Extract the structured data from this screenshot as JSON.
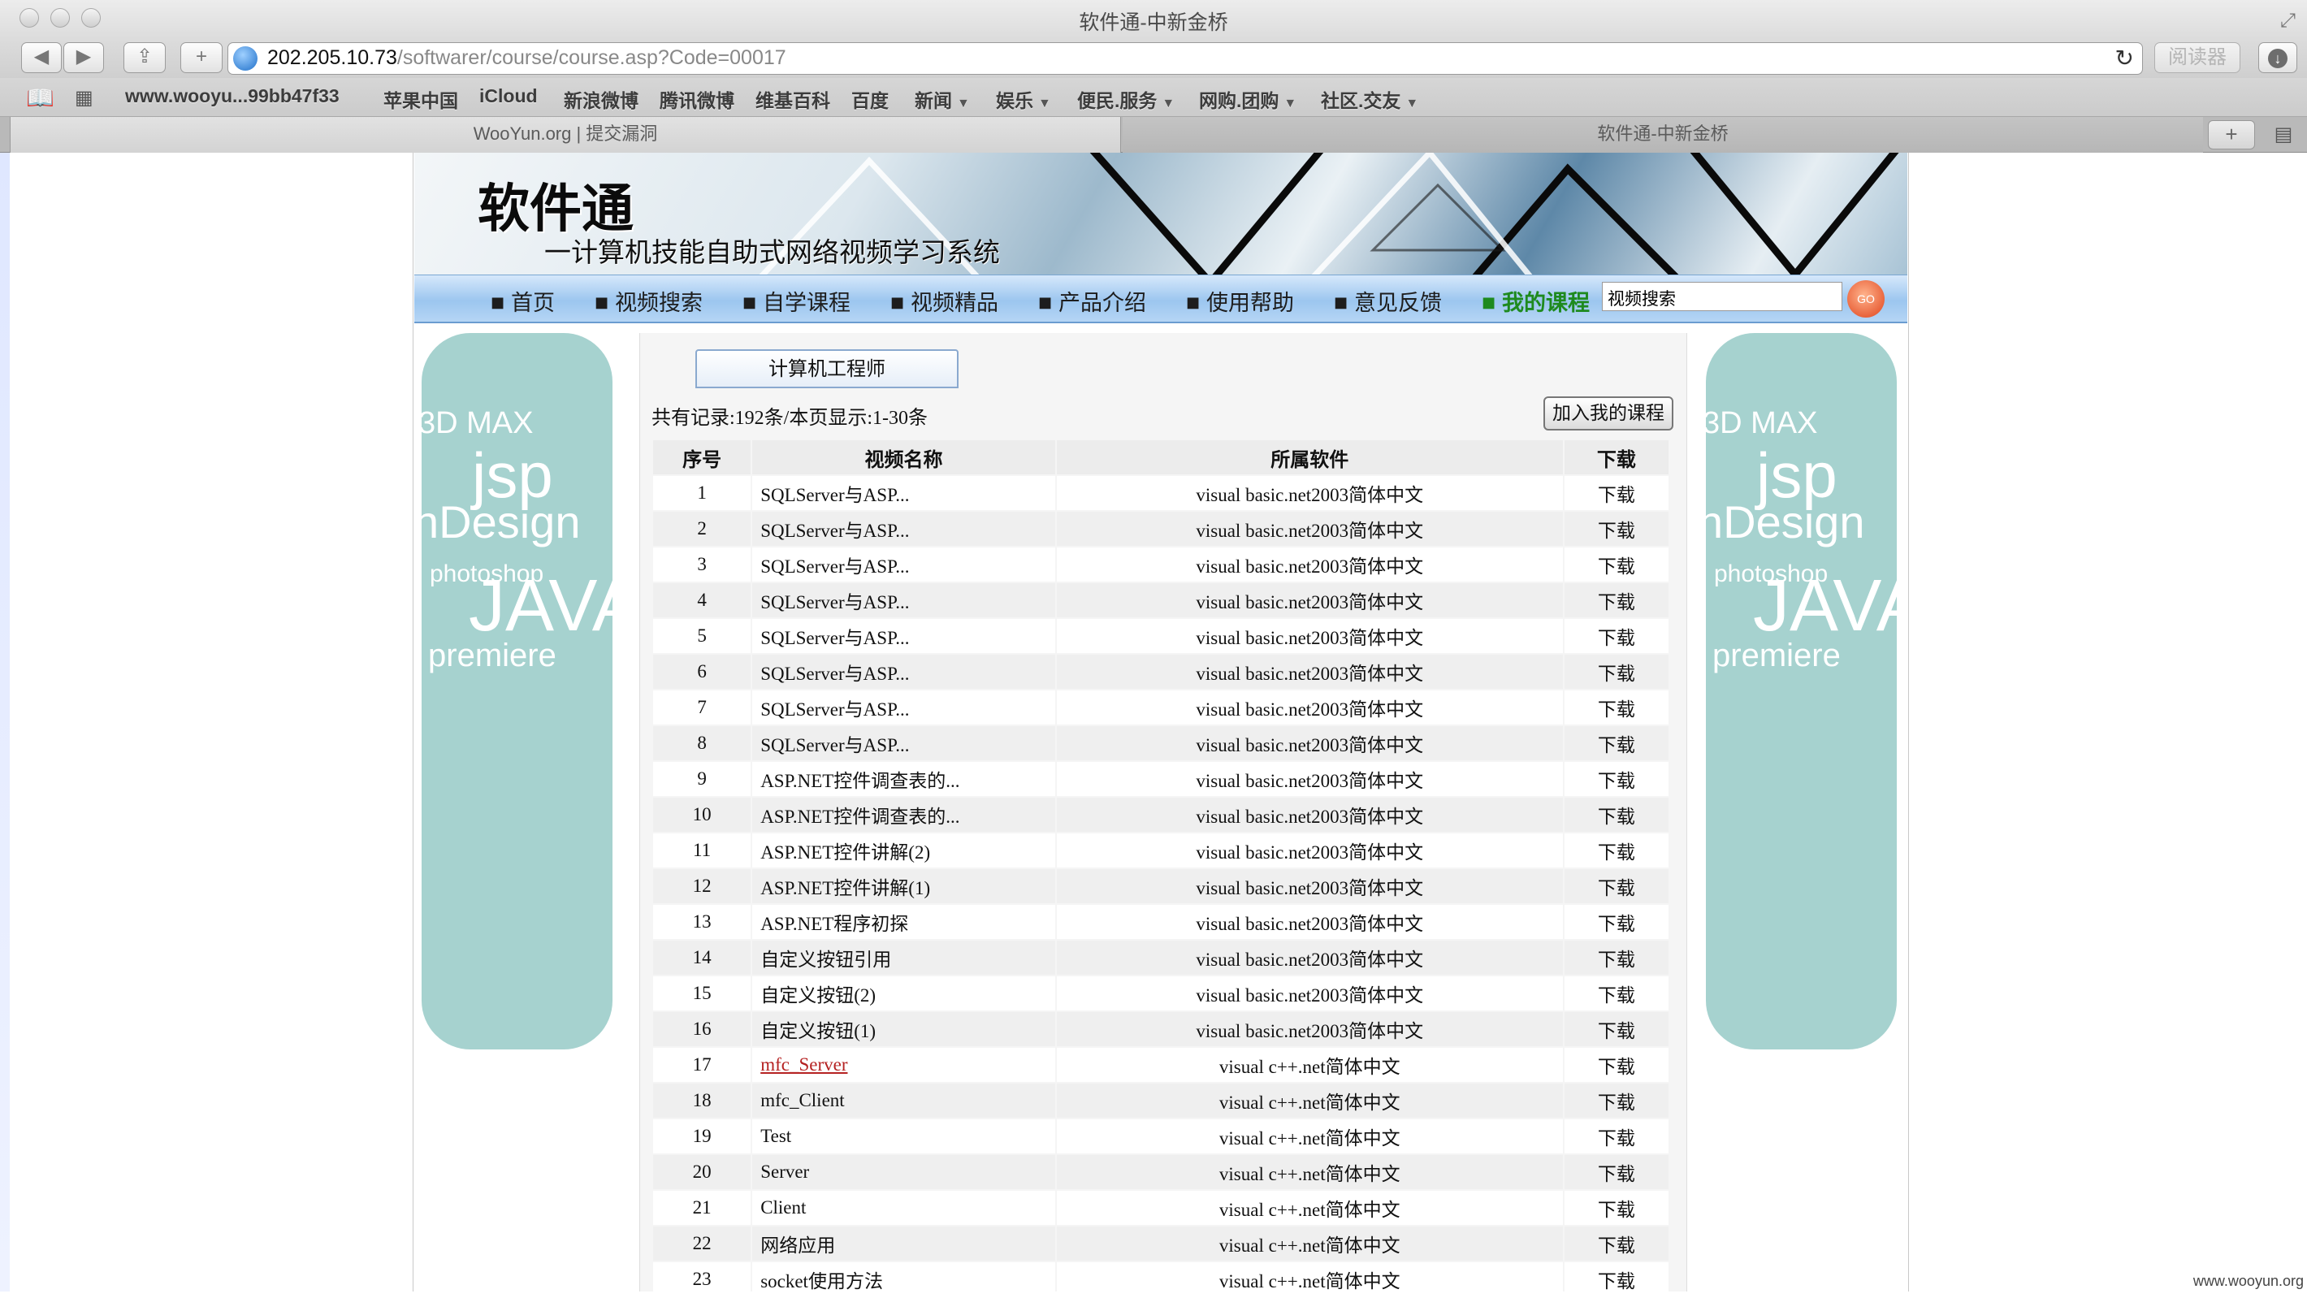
{
  "window": {
    "title": "软件通-中新金桥"
  },
  "toolbar": {
    "url_host": "202.205.10.73",
    "url_path": "/softwarer/course/course.asp?Code=00017",
    "reader_label": "阅读器"
  },
  "bookmarks": [
    {
      "label": "www.wooyu...99bb47f33"
    },
    {
      "label": "苹果中国"
    },
    {
      "label": "iCloud"
    },
    {
      "label": "新浪微博"
    },
    {
      "label": "腾讯微博"
    },
    {
      "label": "维基百科"
    },
    {
      "label": "百度"
    },
    {
      "label": "新闻"
    },
    {
      "label": "娱乐"
    },
    {
      "label": "便民.服务"
    },
    {
      "label": "网购.团购"
    },
    {
      "label": "社区.交友"
    }
  ],
  "tabs": [
    {
      "label": "WooYun.org | 提交漏洞"
    },
    {
      "label": "软件通-中新金桥"
    }
  ],
  "banner": {
    "title": "软件通",
    "subtitle": "一计算机技能自助式网络视频学习系统"
  },
  "nav": {
    "items": [
      "首页",
      "视频搜索",
      "自学课程",
      "视频精品",
      "产品介绍",
      "使用帮助",
      "意见反馈",
      "我的课程"
    ],
    "search_value": "视频搜索",
    "go_label": "GO"
  },
  "side_words": {
    "w1": "3D MAX",
    "w2": "jsp",
    "w3": "nDesign",
    "w4": "photoshop",
    "w5": "JAVA",
    "w6": "premiere"
  },
  "content": {
    "category_tab": "计算机工程师",
    "records_text": "共有记录:192条/本页显示:1-30条",
    "add_button": "加入我的课程",
    "columns": [
      "序号",
      "视频名称",
      "所属软件",
      "下载"
    ],
    "rows": [
      {
        "no": "1",
        "name": "SQLServer与ASP...",
        "software": "visual basic.net2003简体中文",
        "dl": "下载"
      },
      {
        "no": "2",
        "name": "SQLServer与ASP...",
        "software": "visual basic.net2003简体中文",
        "dl": "下载"
      },
      {
        "no": "3",
        "name": "SQLServer与ASP...",
        "software": "visual basic.net2003简体中文",
        "dl": "下载"
      },
      {
        "no": "4",
        "name": "SQLServer与ASP...",
        "software": "visual basic.net2003简体中文",
        "dl": "下载"
      },
      {
        "no": "5",
        "name": "SQLServer与ASP...",
        "software": "visual basic.net2003简体中文",
        "dl": "下载"
      },
      {
        "no": "6",
        "name": "SQLServer与ASP...",
        "software": "visual basic.net2003简体中文",
        "dl": "下载"
      },
      {
        "no": "7",
        "name": "SQLServer与ASP...",
        "software": "visual basic.net2003简体中文",
        "dl": "下载"
      },
      {
        "no": "8",
        "name": "SQLServer与ASP...",
        "software": "visual basic.net2003简体中文",
        "dl": "下载"
      },
      {
        "no": "9",
        "name": "ASP.NET控件调查表的...",
        "software": "visual basic.net2003简体中文",
        "dl": "下载"
      },
      {
        "no": "10",
        "name": "ASP.NET控件调查表的...",
        "software": "visual basic.net2003简体中文",
        "dl": "下载"
      },
      {
        "no": "11",
        "name": "ASP.NET控件讲解(2)",
        "software": "visual basic.net2003简体中文",
        "dl": "下载"
      },
      {
        "no": "12",
        "name": "ASP.NET控件讲解(1)",
        "software": "visual basic.net2003简体中文",
        "dl": "下载"
      },
      {
        "no": "13",
        "name": "ASP.NET程序初探",
        "software": "visual basic.net2003简体中文",
        "dl": "下载"
      },
      {
        "no": "14",
        "name": "自定义按钮引用",
        "software": "visual basic.net2003简体中文",
        "dl": "下载"
      },
      {
        "no": "15",
        "name": "自定义按钮(2)",
        "software": "visual basic.net2003简体中文",
        "dl": "下载"
      },
      {
        "no": "16",
        "name": "自定义按钮(1)",
        "software": "visual basic.net2003简体中文",
        "dl": "下载"
      },
      {
        "no": "17",
        "name": "mfc_Server",
        "software": "visual c++.net简体中文",
        "dl": "下载",
        "link": true
      },
      {
        "no": "18",
        "name": "mfc_Client",
        "software": "visual c++.net简体中文",
        "dl": "下载"
      },
      {
        "no": "19",
        "name": "Test",
        "software": "visual c++.net简体中文",
        "dl": "下载"
      },
      {
        "no": "20",
        "name": "Server",
        "software": "visual c++.net简体中文",
        "dl": "下载"
      },
      {
        "no": "21",
        "name": "Client",
        "software": "visual c++.net简体中文",
        "dl": "下载"
      },
      {
        "no": "22",
        "name": "网络应用",
        "software": "visual c++.net简体中文",
        "dl": "下载"
      },
      {
        "no": "23",
        "name": "socket使用方法",
        "software": "visual c++.net简体中文",
        "dl": "下载"
      }
    ]
  },
  "watermark": "www.wooyun.org",
  "colors": {
    "side_panel": "#a6d2cf",
    "nav_bg": "#9cc6ef",
    "my_course": "#1e8a1e",
    "link": "#b52222"
  }
}
